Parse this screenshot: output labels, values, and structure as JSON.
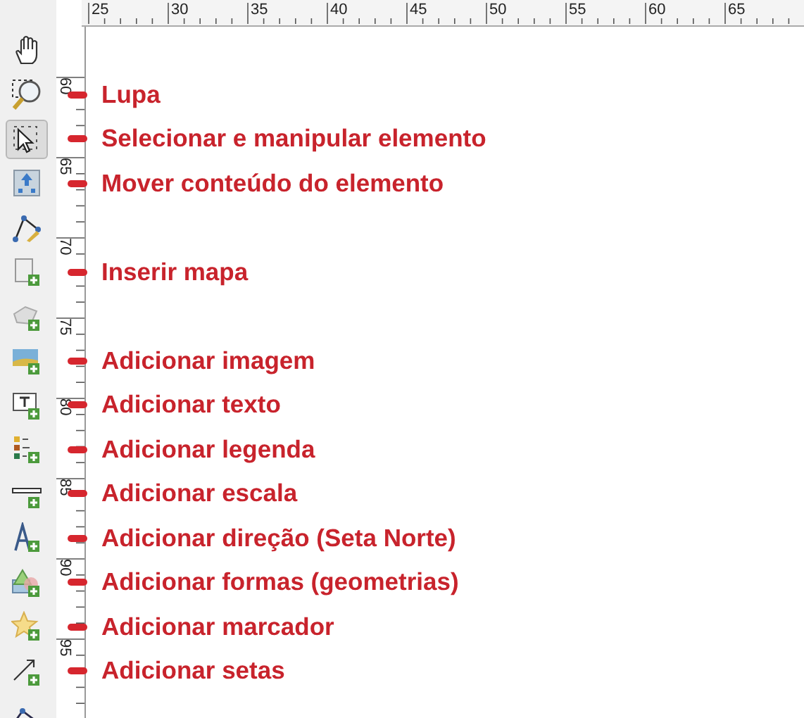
{
  "top_ruler": {
    "labels": [
      "25",
      "30",
      "35",
      "40",
      "45",
      "50",
      "55",
      "60",
      "65"
    ]
  },
  "left_ruler": {
    "labels": [
      "60",
      "65",
      "70",
      "75",
      "80",
      "85",
      "90",
      "95"
    ]
  },
  "toolbar": {
    "tools": [
      {
        "kind": "hand",
        "selected": false
      },
      {
        "kind": "zoom",
        "selected": false,
        "annotation": "Lupa"
      },
      {
        "kind": "select",
        "selected": true,
        "annotation": "Selecionar e manipular elemento"
      },
      {
        "kind": "move",
        "selected": false,
        "annotation": "Mover conteúdo do elemento"
      },
      {
        "kind": "nodes",
        "selected": false
      },
      {
        "kind": "map",
        "selected": false,
        "annotation": "Inserir mapa"
      },
      {
        "kind": "map3d",
        "selected": false
      },
      {
        "kind": "image",
        "selected": false,
        "annotation": "Adicionar imagem"
      },
      {
        "kind": "text",
        "selected": false,
        "annotation": "Adicionar texto"
      },
      {
        "kind": "legend",
        "selected": false,
        "annotation": "Adicionar legenda"
      },
      {
        "kind": "scale",
        "selected": false,
        "annotation": "Adicionar escala"
      },
      {
        "kind": "north",
        "selected": false,
        "annotation": "Adicionar direção (Seta Norte)"
      },
      {
        "kind": "shapes",
        "selected": false,
        "annotation": "Adicionar formas (geometrias)"
      },
      {
        "kind": "marker",
        "selected": false,
        "annotation": "Adicionar marcador"
      },
      {
        "kind": "arrow",
        "selected": false,
        "annotation": "Adicionar setas"
      },
      {
        "kind": "polyline",
        "selected": false
      }
    ]
  }
}
